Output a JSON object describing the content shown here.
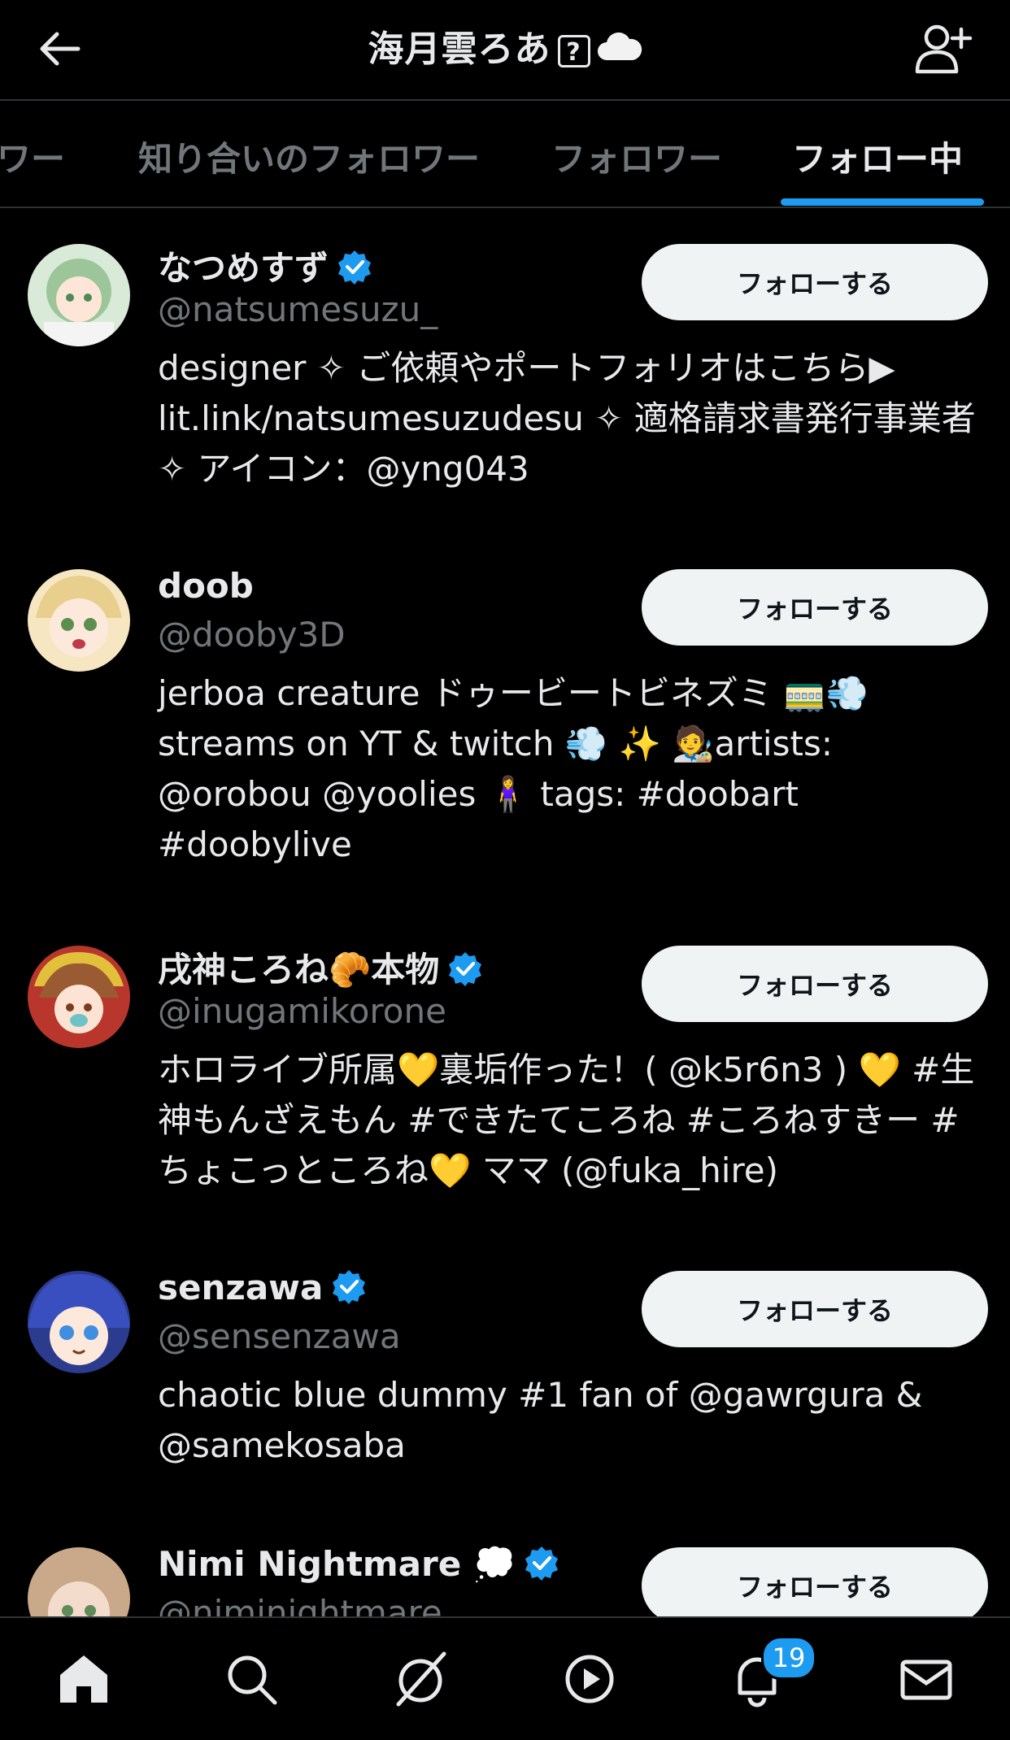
{
  "header": {
    "title": "海月雲ろあ",
    "title_badge": "?",
    "title_emoji": "cloud-icon"
  },
  "tabs": [
    {
      "label": "ワー",
      "active": false
    },
    {
      "label": "知り合いのフォロワー",
      "active": false
    },
    {
      "label": "フォロワー",
      "active": false
    },
    {
      "label": "フォロー中",
      "active": true
    }
  ],
  "accent_color": "#1d9bf0",
  "users": [
    {
      "name": "なつめすず",
      "verified": true,
      "handle": "@natsumesuzu_",
      "bio": "designer ✧ ご依頼やポートフォリオはこちら▶ lit.link/natsumesuzudesu ✧ 適格請求書発行事業者 ✧ アイコン：@yng043",
      "button": "フォローする"
    },
    {
      "name": "doob",
      "verified": false,
      "handle": "@dooby3D",
      "bio": "jerboa creature ドゥービートビネズミ 🚃💨 streams on YT & twitch 💨 ✨ 🧑‍🎨artists: @orobou @yoolies 🧍‍♀️ tags: #doobart #doobylive",
      "button": "フォローする"
    },
    {
      "name": "戌神ころね🥐本物",
      "verified": true,
      "handle": "@inugamikorone",
      "bio": "ホロライブ所属💛裏垢作った！( @k5r6n3 ) 💛 #生神もんざえもん #できたてころね #ころねすきー #ちょこっところね💛 ママ (@fuka_hire)",
      "button": "フォローする"
    },
    {
      "name": "senzawa",
      "verified": true,
      "handle": "@sensenzawa",
      "bio": "chaotic blue dummy #1 fan of @gawrgura & @samekosaba",
      "button": "フォローする"
    },
    {
      "name": "Nimi Nightmare 💭",
      "verified": true,
      "handle": "@niminightmare",
      "bio": "",
      "button": "フォローする"
    }
  ],
  "bottom_nav": {
    "items": [
      "home-icon",
      "search-icon",
      "grok-icon",
      "video-icon",
      "notifications-icon",
      "messages-icon"
    ],
    "notification_count": "19"
  }
}
